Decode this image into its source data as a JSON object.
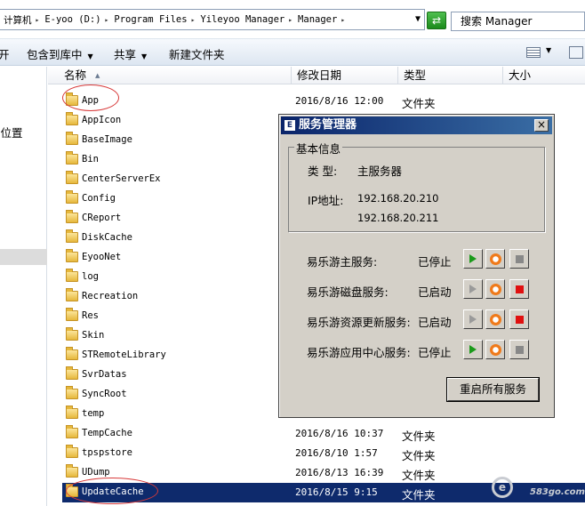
{
  "address_bar": {
    "crumbs": [
      "计算机",
      "E-yoo (D:)",
      "Program Files",
      "Yileyoo Manager",
      "Manager"
    ],
    "go_icon": "refresh-go-icon",
    "search_text": "搜索 Manager"
  },
  "toolbar": {
    "open_label": "开",
    "include_label": "包含到库中",
    "share_label": "共享",
    "new_folder_label": "新建文件夹"
  },
  "nav": {
    "item_label": "的位置"
  },
  "columns": {
    "name": "名称",
    "date": "修改日期",
    "type": "类型",
    "size": "大小"
  },
  "files": [
    {
      "name": "App",
      "date": "2016/8/16 12:00",
      "type": "文件夹"
    },
    {
      "name": "AppIcon",
      "date": "",
      "type": ""
    },
    {
      "name": "BaseImage",
      "date": "",
      "type": ""
    },
    {
      "name": "Bin",
      "date": "",
      "type": ""
    },
    {
      "name": "CenterServerEx",
      "date": "",
      "type": ""
    },
    {
      "name": "Config",
      "date": "",
      "type": ""
    },
    {
      "name": "CReport",
      "date": "",
      "type": ""
    },
    {
      "name": "DiskCache",
      "date": "",
      "type": ""
    },
    {
      "name": "EyooNet",
      "date": "",
      "type": ""
    },
    {
      "name": "log",
      "date": "",
      "type": ""
    },
    {
      "name": "Recreation",
      "date": "",
      "type": ""
    },
    {
      "name": "Res",
      "date": "",
      "type": ""
    },
    {
      "name": "Skin",
      "date": "",
      "type": ""
    },
    {
      "name": "STRemoteLibrary",
      "date": "",
      "type": ""
    },
    {
      "name": "SvrDatas",
      "date": "",
      "type": ""
    },
    {
      "name": "SyncRoot",
      "date": "",
      "type": ""
    },
    {
      "name": "temp",
      "date": "",
      "type": ""
    },
    {
      "name": "TempCache",
      "date": "2016/8/16 10:37",
      "type": "文件夹"
    },
    {
      "name": "tpspstore",
      "date": "2016/8/10 1:57",
      "type": "文件夹"
    },
    {
      "name": "UDump",
      "date": "2016/8/13 16:39",
      "type": "文件夹"
    },
    {
      "name": "UpdateCache",
      "date": "2016/8/15 9:15",
      "type": "文件夹"
    }
  ],
  "dialog": {
    "title": "服务管理器",
    "close": "×",
    "basic_info": {
      "legend": "基本信息",
      "type_label": "类 型:",
      "type_value": "主服务器",
      "ip_label": "IP地址:",
      "ip1": "192.168.20.210",
      "ip2": "192.168.20.211"
    },
    "services": [
      {
        "name": "易乐游主服务:",
        "status": "已停止"
      },
      {
        "name": "易乐游磁盘服务:",
        "status": "已启动"
      },
      {
        "name": "易乐游资源更新服务:",
        "status": "已启动"
      },
      {
        "name": "易乐游应用中心服务:",
        "status": "已停止"
      }
    ],
    "restart_all": "重启所有服务"
  },
  "watermark": {
    "text": "583go.com"
  },
  "colors": {
    "selected_row": "#0e2a6c",
    "title_bar": "#0a246a",
    "annotation": "#d83a3a"
  }
}
